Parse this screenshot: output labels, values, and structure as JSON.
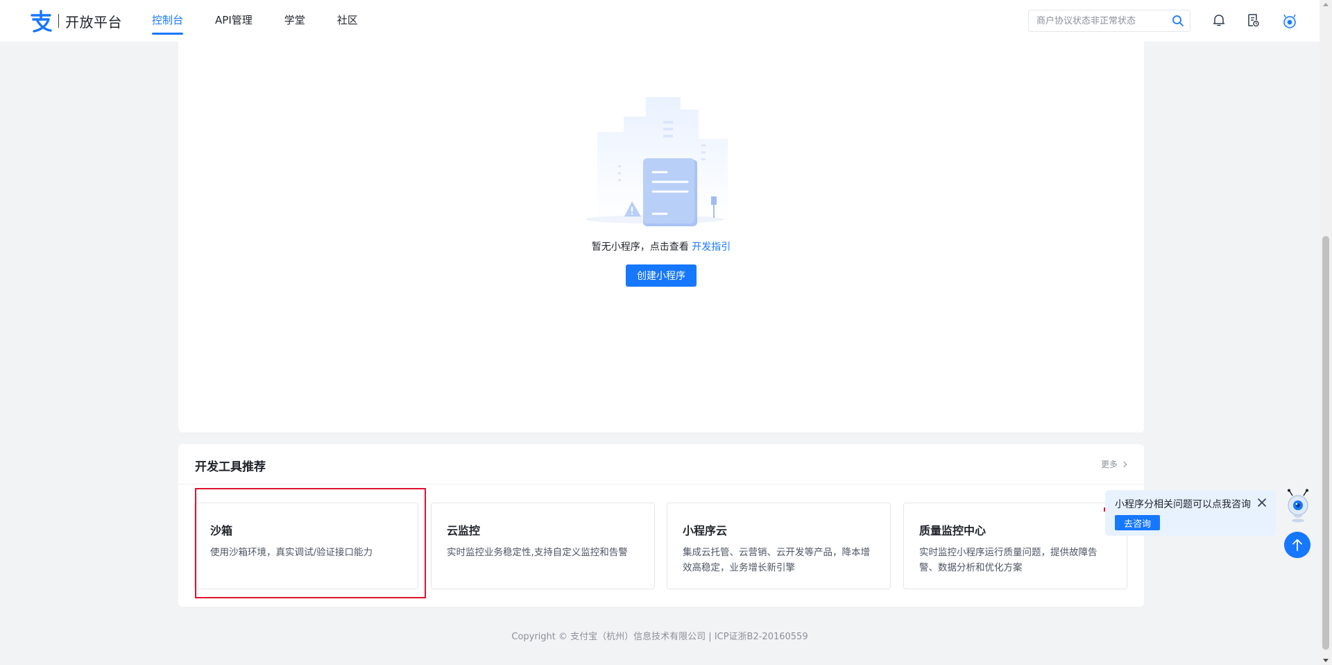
{
  "header": {
    "logo_text": "开放平台",
    "nav": [
      {
        "label": "控制台",
        "active": true
      },
      {
        "label": "API管理",
        "active": false
      },
      {
        "label": "学堂",
        "active": false
      },
      {
        "label": "社区",
        "active": false
      }
    ],
    "search_placeholder": "商户协议状态非正常状态",
    "icons": [
      "search-icon",
      "bell-icon",
      "document-icon",
      "robot-avatar-icon"
    ]
  },
  "empty_state": {
    "text": "暂无小程序，点击查看",
    "link": "开发指引",
    "button": "创建小程序"
  },
  "tools": {
    "title": "开发工具推荐",
    "more": "更多",
    "items": [
      {
        "name": "沙箱",
        "desc": "使用沙箱环境，真实调试/验证接口能力",
        "highlighted": true
      },
      {
        "name": "云监控",
        "desc": "实时监控业务稳定性,支持自定义监控和告警",
        "highlighted": false
      },
      {
        "name": "小程序云",
        "desc": "集成云托管、云营销、云开发等产品，降本增效高稳定，业务增长新引擎",
        "highlighted": false
      },
      {
        "name": "质量监控中心",
        "desc": "实时监控小程序运行质量问题，提供故障告警、数据分析和优化方案",
        "highlighted": false
      }
    ]
  },
  "footer": {
    "text": "Copyright © 支付宝（杭州）信息技术有限公司 | ICP证浙B2-20160559"
  },
  "assistant": {
    "message": "小程序分相关问题可以点我咨询",
    "button": "去咨询"
  },
  "colors": {
    "primary": "#1677ff",
    "highlight_border": "#e0102d",
    "page_bg": "#f2f3f5"
  }
}
